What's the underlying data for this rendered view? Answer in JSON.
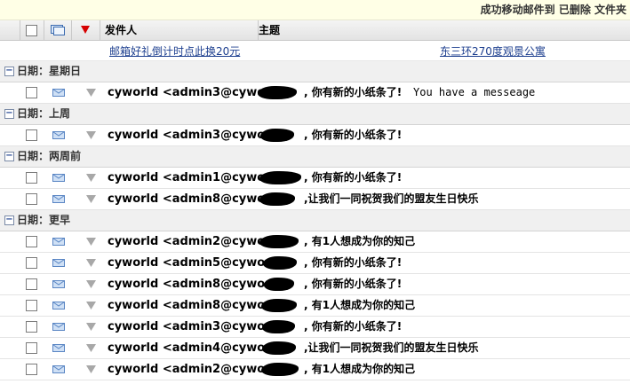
{
  "notice": {
    "text": "成功移动邮件到 已删除 文件夹"
  },
  "columns": {
    "sender": "发件人",
    "subject": "主题"
  },
  "ads": [
    {
      "text": "邮箱好礼倒计时点此换20元"
    },
    {
      "text": "东三环270度观景公寓"
    }
  ],
  "groups": [
    {
      "label": "日期：星期日"
    },
    {
      "label": "日期：上周"
    },
    {
      "label": "日期：两周前"
    },
    {
      "label": "日期：更早"
    }
  ],
  "emails": [
    {
      "sender": "cyworld <admin3@cywor",
      "subject": ", 你有新的小纸条了!",
      "extra": "You have a messeage"
    },
    {
      "sender": "cyworld <admin3@cywor",
      "subject": ", 你有新的小纸条了!"
    },
    {
      "sender": "cyworld <admin1@cywor",
      "subject": ", 你有新的小纸条了!"
    },
    {
      "sender": "cyworld <admin8@cywor",
      "subject": ",让我们一同祝贺我们的盟友生日快乐"
    },
    {
      "sender": "cyworld <admin2@cywor",
      "subject": ", 有1人想成为你的知己"
    },
    {
      "sender": "cyworld <admin5@cywor",
      "subject": ", 你有新的小纸条了!"
    },
    {
      "sender": "cyworld <admin8@cywor",
      "subject": ", 你有新的小纸条了!"
    },
    {
      "sender": "cyworld <admin8@cywor",
      "subject": ", 有1人想成为你的知己"
    },
    {
      "sender": "cyworld <admin3@cywor",
      "subject": ", 你有新的小纸条了!"
    },
    {
      "sender": "cyworld <admin4@cywor",
      "subject": ",让我们一同祝贺我们的盟友生日快乐"
    },
    {
      "sender": "cyworld <admin2@cywor",
      "subject": ", 有1人想成为你的知己"
    }
  ]
}
